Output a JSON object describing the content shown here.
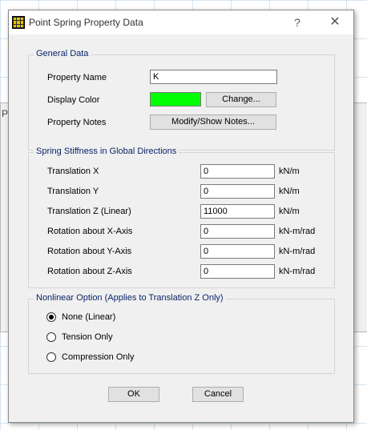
{
  "colors": {
    "display_color": "#00ff00",
    "legend_text": "#0a246a"
  },
  "background": {
    "title_fragment": "Po"
  },
  "dialog": {
    "title": "Point Spring Property Data",
    "help_icon": "?",
    "close_icon": "✕"
  },
  "general": {
    "legend": "General Data",
    "property_name_label": "Property Name",
    "property_name_value": "K",
    "display_color_label": "Display Color",
    "change_button": "Change...",
    "property_notes_label": "Property Notes",
    "notes_button": "Modify/Show Notes..."
  },
  "stiffness": {
    "legend": "Spring Stiffness in Global Directions",
    "rows": [
      {
        "label": "Translation  X",
        "value": "0",
        "unit": "kN/m"
      },
      {
        "label": "Translation  Y",
        "value": "0",
        "unit": "kN/m"
      },
      {
        "label": "Translation  Z  (Linear)",
        "value": "11000",
        "unit": "kN/m"
      },
      {
        "label": "Rotation about  X-Axis",
        "value": "0",
        "unit": "kN-m/rad"
      },
      {
        "label": "Rotation about  Y-Axis",
        "value": "0",
        "unit": "kN-m/rad"
      },
      {
        "label": "Rotation about  Z-Axis",
        "value": "0",
        "unit": "kN-m/rad"
      }
    ]
  },
  "nonlinear": {
    "legend": "Nonlinear Option  (Applies to Translation Z Only)",
    "options": [
      {
        "label": "None (Linear)",
        "selected": true
      },
      {
        "label": "Tension Only",
        "selected": false
      },
      {
        "label": "Compression Only",
        "selected": false
      }
    ]
  },
  "footer": {
    "ok": "OK",
    "cancel": "Cancel"
  }
}
